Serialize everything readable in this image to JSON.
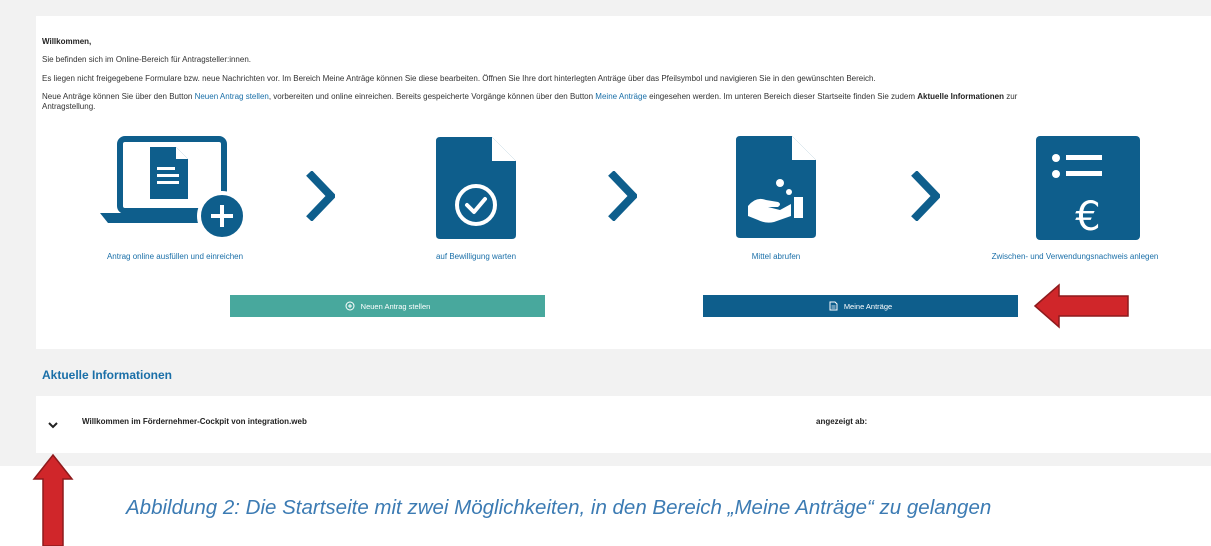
{
  "welcome": "Willkommen,",
  "intro_lines": [
    "Sie befinden sich im Online-Bereich für Antragsteller:innen.",
    "Es liegen nicht freigegebene Formulare bzw. neue Nachrichten vor. Im Bereich Meine Anträge können Sie diese bearbeiten. Öffnen Sie Ihre dort hinterlegten Anträge über das Pfeilsymbol und navigieren Sie in den gewünschten Bereich."
  ],
  "para": {
    "p1": "Neue Anträge können Sie über den Button ",
    "link1": "Neuen Antrag stellen",
    "p2": ", vorbereiten und online einreichen. Bereits gespeicherte Vorgänge können über den Button ",
    "link2": "Meine Anträge",
    "p3": " eingesehen werden. Im unteren Bereich dieser Startseite finden Sie zudem ",
    "bold": "Aktuelle Informationen",
    "p4": " zur",
    "p5": "Antragstellung."
  },
  "steps": [
    {
      "label": "Antrag online ausfüllen und einreichen",
      "icon": "laptop-document-add-icon"
    },
    {
      "label": "auf Bewilligung warten",
      "icon": "document-check-icon"
    },
    {
      "label": "Mittel abrufen",
      "icon": "document-hand-coins-icon"
    },
    {
      "label": "Zwischen- und Verwendungsnachweis anlegen",
      "icon": "document-list-euro-icon"
    }
  ],
  "buttons": {
    "new_application": "Neuen Antrag stellen",
    "my_applications": "Meine Anträge"
  },
  "news": {
    "section_title": "Aktuelle Informationen",
    "item_title": "Willkommen im Fördernehmer-Cockpit von integration.web",
    "shown_from_label": "angezeigt ab:"
  },
  "caption": "Abbildung 2: Die Startseite mit zwei Möglichkeiten, in den Bereich „Meine Anträge“ zu gelangen",
  "colors": {
    "icon_blue": "#0e5e8c",
    "link_blue": "#1a6fa8",
    "teal": "#48a89d",
    "annotation_red": "#d0262a",
    "caption_blue": "#3c7bb3"
  }
}
